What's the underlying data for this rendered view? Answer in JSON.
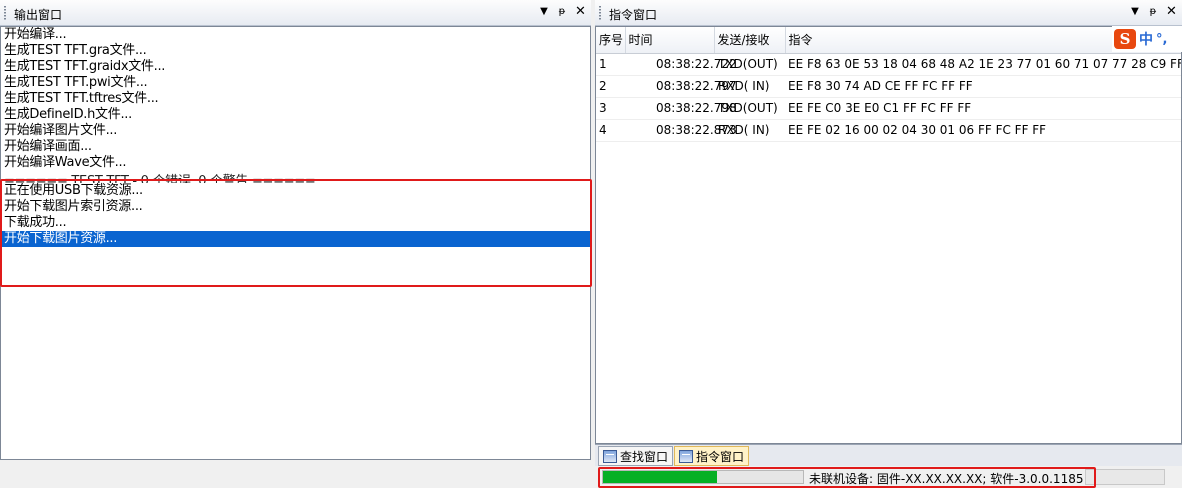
{
  "output_pane": {
    "title": "输出窗口",
    "lines": [
      "开始编译...",
      "生成TEST TFT.gra文件...",
      "生成TEST TFT.graidx文件...",
      "生成TEST TFT.pwi文件...",
      "生成TEST TFT.tftres文件...",
      "生成DefineID.h文件...",
      "开始编译图片文件...",
      "开始编译画面...",
      "开始编译Wave文件...",
      "====== TEST TFT - 0 个错误, 0 个警告 ======",
      "正在使用USB下载资源...",
      "开始下载图片索引资源...",
      "下载成功...",
      "开始下载图片资源..."
    ]
  },
  "command_pane": {
    "title": "指令窗口",
    "columns": [
      "序号",
      "时间",
      "发送/接收",
      "指令"
    ],
    "rows": [
      [
        "1",
        "08:38:22.722",
        "TXD(OUT)",
        "EE F8 63 0E 53 18 04 68 48 A2 1E 23 77 01 60 71 07 77 28 C9 FF FC"
      ],
      [
        "2",
        "08:38:22.797",
        "RXD( IN)",
        "EE F8 30 74 AD CE FF FC FF FF"
      ],
      [
        "3",
        "08:38:22.798",
        "TXD(OUT)",
        "EE FE C0 3E E0 C1 FF FC FF FF"
      ],
      [
        "4",
        "08:38:22.873",
        "RXD( IN)",
        "EE FE 02 16 00 02 04 30 01 06 FF FC FF FF"
      ]
    ],
    "ime": {
      "logo": "S",
      "mode": "中",
      "punct": "°,"
    }
  },
  "tabs": [
    {
      "label": "查找窗口",
      "active": false
    },
    {
      "label": "指令窗口",
      "active": true
    }
  ],
  "status": {
    "progress_fraction": 0.57,
    "text": "未联机设备: 固件-XX.XX.XX.XX;  软件-3.0.0.1185"
  },
  "colors": {
    "highlight_border": "#e01a1a",
    "selection": "#0a64d0",
    "progress": "#06b025"
  },
  "icons": {
    "pane_menu": "dropdown-arrow-icon",
    "pane_pin": "pin-icon",
    "pane_close": "close-icon",
    "tab": "window-icon"
  }
}
